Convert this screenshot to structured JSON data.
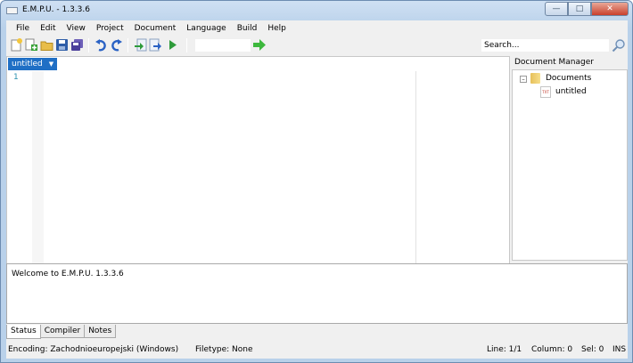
{
  "window": {
    "title": "E.M.P.U. - 1.3.3.6"
  },
  "menu": [
    "File",
    "Edit",
    "View",
    "Project",
    "Document",
    "Language",
    "Build",
    "Help"
  ],
  "toolbar": {
    "icons": [
      "new-file-icon",
      "add-file-icon",
      "open-folder-icon",
      "save-icon",
      "save-all-icon",
      "undo-icon",
      "redo-icon",
      "import-icon",
      "export-icon",
      "run-icon",
      "goto-arrow-icon"
    ],
    "search_placeholder": "Search..."
  },
  "editor": {
    "tab_label": "untitled",
    "line_numbers": [
      "1"
    ]
  },
  "document_manager": {
    "title": "Document Manager",
    "root": "Documents",
    "file_badge": "TXT",
    "files": [
      "untitled"
    ]
  },
  "output": {
    "message": "Welcome to E.M.P.U. 1.3.3.6"
  },
  "bottom_tabs": [
    "Status",
    "Compiler",
    "Notes"
  ],
  "statusbar": {
    "encoding": "Encoding: Zachodnioeuropejski (Windows)",
    "filetype": "Filetype: None",
    "line": "Line: 1/1",
    "column": "Column: 0",
    "sel": "Sel: 0",
    "mode": "INS"
  },
  "colors": {
    "tab_active": "#1f6fc5",
    "line_number": "#2b91af",
    "go_arrow": "#3db83d"
  }
}
